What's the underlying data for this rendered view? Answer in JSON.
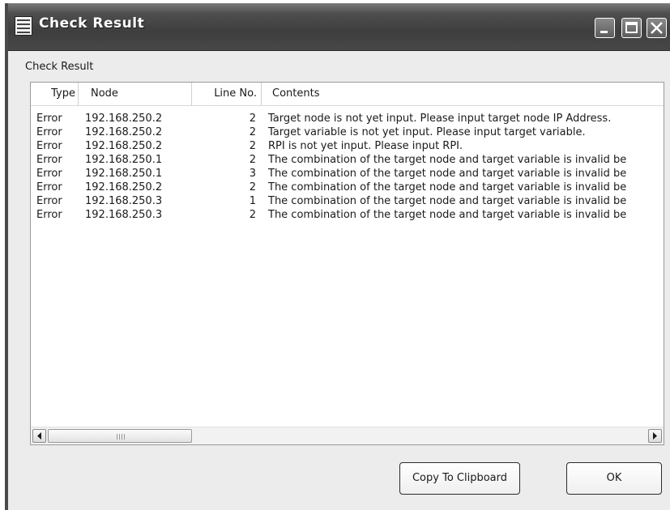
{
  "window": {
    "title": "Check Result"
  },
  "group": {
    "label": "Check Result"
  },
  "table": {
    "columns": {
      "type": "Type",
      "node": "Node",
      "line": "Line No.",
      "contents": "Contents"
    },
    "rows": [
      {
        "type": "Error",
        "node": "192.168.250.2",
        "line": "2",
        "contents": "Target node is not yet input. Please input target node IP Address."
      },
      {
        "type": "Error",
        "node": "192.168.250.2",
        "line": "2",
        "contents": "Target variable is not yet input. Please input target variable."
      },
      {
        "type": "Error",
        "node": "192.168.250.2",
        "line": "2",
        "contents": "RPI is not yet input. Please input RPI."
      },
      {
        "type": "Error",
        "node": "192.168.250.1",
        "line": "2",
        "contents": "The combination of the target node and target variable is invalid be"
      },
      {
        "type": "Error",
        "node": "192.168.250.1",
        "line": "3",
        "contents": "The combination of the target node and target variable is invalid be"
      },
      {
        "type": "Error",
        "node": "192.168.250.2",
        "line": "2",
        "contents": "The combination of the target node and target variable is invalid be"
      },
      {
        "type": "Error",
        "node": "192.168.250.3",
        "line": "1",
        "contents": "The combination of the target node and target variable is invalid be"
      },
      {
        "type": "Error",
        "node": "192.168.250.3",
        "line": "2",
        "contents": "The combination of the target node and target variable is invalid be"
      }
    ]
  },
  "buttons": {
    "copy": "Copy To Clipboard",
    "ok": "OK"
  },
  "icons": {
    "app": "list-icon",
    "minimize": "minimize-icon",
    "maximize": "maximize-icon",
    "close": "close-icon",
    "scroll_left": "arrow-left-icon",
    "scroll_right": "arrow-right-icon"
  }
}
